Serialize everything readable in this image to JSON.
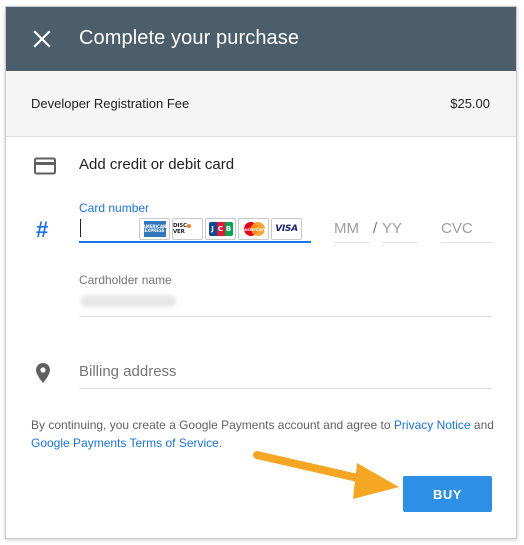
{
  "dialog": {
    "title": "Complete your purchase",
    "close_icon": "close-icon",
    "header_color": "#4b5e6a"
  },
  "order": {
    "item_label": "Developer Registration Fee",
    "amount": "$25.00"
  },
  "payment": {
    "section_label": "Add credit or debit card",
    "card_icon": "credit-card-icon",
    "hash_icon": "#",
    "card_number_label": "Card number",
    "card_brands": [
      "American Express",
      "Discover",
      "JCB",
      "MasterCard",
      "VISA"
    ],
    "month_placeholder": "MM",
    "separator": "/",
    "year_placeholder": "YY",
    "cvc_placeholder": "CVC",
    "cardholder_label": "Cardholder name",
    "billing_placeholder": "Billing address",
    "pin_icon": "location-pin-icon"
  },
  "legal": {
    "prefix": "By continuing, you create a Google Payments account and agree to ",
    "privacy_link": "Privacy Notice",
    "middle": " and ",
    "terms_link": "Google Payments Terms of Service",
    "suffix": "."
  },
  "actions": {
    "buy_label": "BUY",
    "accent_color": "#2d8fe5"
  }
}
